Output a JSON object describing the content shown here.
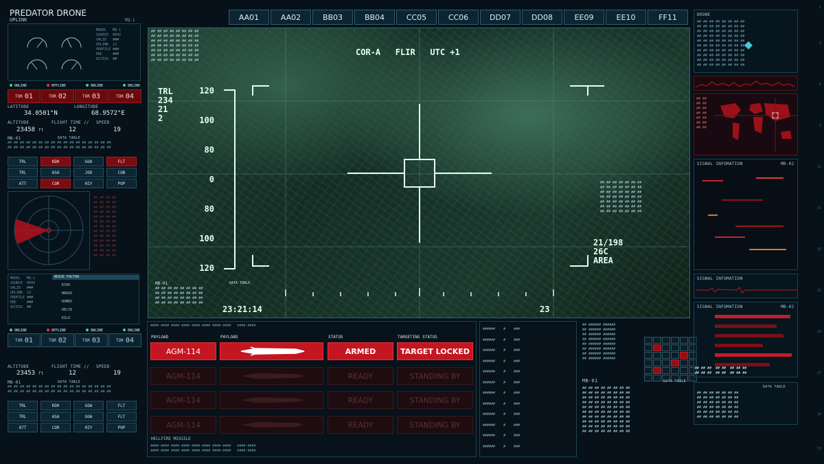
{
  "header": {
    "title": "PREDATOR DRONE",
    "subtitle": "UPLINK",
    "id": "MQ-1"
  },
  "tabs": [
    "AA01",
    "AA02",
    "BB03",
    "BB04",
    "CC05",
    "CC06",
    "DD07",
    "DD08",
    "EE09",
    "EE10",
    "FF11"
  ],
  "left": {
    "status_row": [
      "ONLINE",
      "OFFLINE",
      "ONLINE",
      "ONLINE"
    ],
    "tor": [
      {
        "label": "TOR",
        "num": "01"
      },
      {
        "label": "TOR",
        "num": "02"
      },
      {
        "label": "TOR",
        "num": "03"
      },
      {
        "label": "TOR",
        "num": "04"
      }
    ],
    "latitude_label": "LATITUDE",
    "latitude": "34.0501°N",
    "longitude_label": "LONGITUDE",
    "longitude": "68.9572°E",
    "altitude_label": "ALTITUDE",
    "altitude": "23458",
    "altitude_unit": "ft",
    "flight_label": "FLIGHT TIME //",
    "flight": "12",
    "speed_label": "SPEED",
    "speed": "19",
    "mb": "MB-01",
    "data_table": "DATA TABLE",
    "codes": [
      [
        "TRL",
        "KDH",
        "GOA",
        "FLT"
      ],
      [
        "TRL",
        "ASA",
        "JOO",
        "COB"
      ],
      [
        "ATT",
        "COR",
        "HIY",
        "POP"
      ]
    ],
    "status_row2": [
      "ONLINE",
      "OFFLINE",
      "ONLINE",
      "ONLINE"
    ],
    "tor2": [
      {
        "label": "TOR",
        "num": "01"
      },
      {
        "label": "TOR",
        "num": "02"
      },
      {
        "label": "TOR",
        "num": "03"
      },
      {
        "label": "TOR",
        "num": "04"
      }
    ],
    "altitude2": "23453",
    "flight2": "12",
    "speed2": "19",
    "codes2": [
      [
        "TRL",
        "KDH",
        "GOA",
        "FLT"
      ],
      [
        "TRL",
        "ASA",
        "GOA",
        "FLT"
      ],
      [
        "ATT",
        "COR",
        "HIY",
        "POP"
      ]
    ],
    "noise_factor": "NOISE FACTOR",
    "list": [
      "ECHO",
      "BRAVO",
      "ROMEO",
      "DELTA",
      "KILO"
    ]
  },
  "video": {
    "top": "COR-A   FLIR   UTC +1",
    "trl": [
      "TRL",
      "234",
      "21",
      "2"
    ],
    "scale": [
      "120",
      "100",
      "80",
      "0",
      "80",
      "100",
      "120"
    ],
    "time": "23:21:14",
    "frame": "23",
    "readout": [
      "21/198",
      "26C",
      "AREA"
    ],
    "mb": "MB-01",
    "data_table": "DATA TABLE"
  },
  "payload": {
    "h_payload": "PAYLOAD",
    "h_payload2": "PAYLOAD",
    "h_status": "STATUS",
    "h_targeting": "TARGETING STATUS",
    "rows": [
      {
        "name": "AGM-114",
        "status": "ARMED",
        "target": "TARGET LOCKED",
        "active": true
      },
      {
        "name": "AGM-114",
        "status": "READY",
        "target": "STANDING BY",
        "active": false
      },
      {
        "name": "AGM-114",
        "status": "READY",
        "target": "STANDING BY",
        "active": false
      },
      {
        "name": "AGM-114",
        "status": "READY",
        "target": "STANDING BY",
        "active": false
      }
    ],
    "footer": "HELLFIRE MISSILE"
  },
  "right": {
    "drone": "DRONE",
    "signal1": "SIGNAL INFOMATION",
    "signal1_id": "MB-02",
    "signal2": "SIGNAL INFOMATION",
    "signal3": "SIGNAL INFOMATION",
    "signal3_id": "MB-02",
    "mb": "MB-01",
    "data_table": "DATA TABLE"
  },
  "colors": {
    "accent_red": "#c41620",
    "panel": "#0d2532",
    "hud": "#e8fff4"
  }
}
